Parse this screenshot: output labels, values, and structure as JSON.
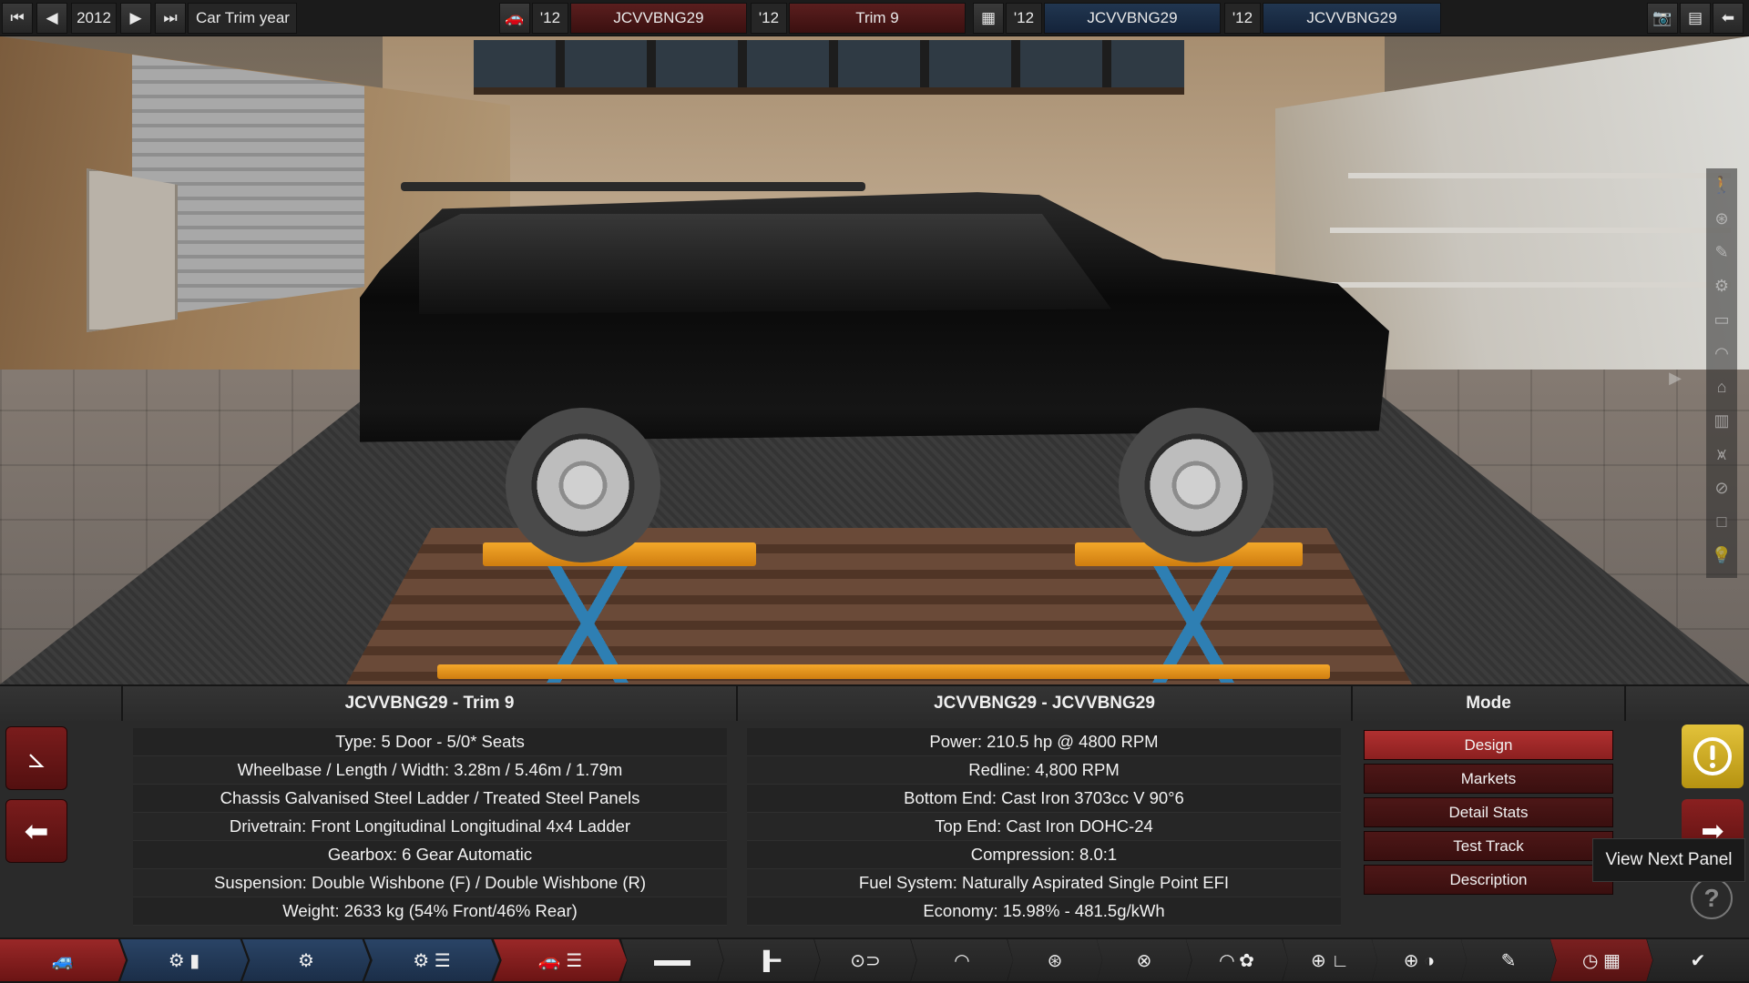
{
  "topbar": {
    "year": "2012",
    "year_label": "Car Trim year",
    "model_year": "'12",
    "model_name": "JCVVBNG29",
    "trim_year": "'12",
    "trim_name": "Trim 9",
    "engine_year": "'12",
    "engine_family": "JCVVBNG29",
    "variant_year": "'12",
    "variant_name": "JCVVBNG29"
  },
  "car_panel": {
    "title": "JCVVBNG29 - Trim 9",
    "stats": [
      "Type: 5 Door - 5/0* Seats",
      "Wheelbase / Length / Width: 3.28m / 5.46m / 1.79m",
      "Chassis Galvanised Steel Ladder / Treated Steel Panels",
      "Drivetrain: Front Longitudinal Longitudinal 4x4 Ladder",
      "Gearbox: 6 Gear Automatic",
      "Suspension: Double Wishbone (F) / Double Wishbone (R)",
      "Weight: 2633 kg (54% Front/46% Rear)"
    ]
  },
  "engine_panel": {
    "title": "JCVVBNG29 - JCVVBNG29",
    "stats": [
      "Power: 210.5 hp @ 4800 RPM",
      "Redline:  4,800 RPM",
      "Bottom End: Cast Iron 3703cc V 90°6",
      "Top End: Cast Iron DOHC-24",
      "Compression: 8.0:1",
      "Fuel System: Naturally Aspirated Single Point EFI",
      "Economy: 15.98% - 481.5g/kWh"
    ]
  },
  "mode_panel": {
    "title": "Mode",
    "buttons": [
      "Design",
      "Markets",
      "Detail Stats",
      "Test Track",
      "Description"
    ],
    "active": "Design"
  },
  "tooltip": "View Next Panel",
  "colors": {
    "accent_red": "#9a2828",
    "accent_blue": "#2a4466",
    "warning_yellow": "#e2c23a"
  },
  "toolbar_icons": [
    "car-body-icon",
    "engine-family-icon",
    "engine-icon",
    "engine-variant-icon",
    "car-trim-icon",
    "chassis-icon",
    "drivetrain-icon",
    "suspension-icon",
    "tires-icon",
    "wheels-icon",
    "brakes-icon",
    "aero-icon",
    "interior-icon",
    "steering-icon",
    "safety-icon",
    "paint-icon",
    "test-track-icon",
    "finish-icon"
  ]
}
